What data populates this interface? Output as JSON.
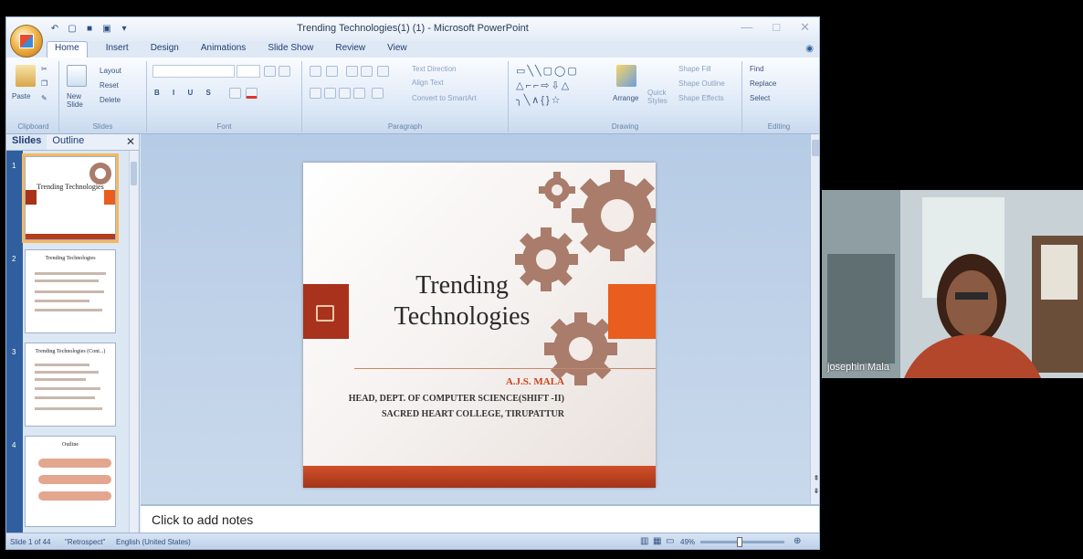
{
  "window": {
    "title": "Trending Technologies(1) (1) - Microsoft PowerPoint"
  },
  "ribbon_tabs": [
    "Home",
    "Insert",
    "Design",
    "Animations",
    "Slide Show",
    "Review",
    "View"
  ],
  "ribbon": {
    "clipboard": {
      "paste": "Paste",
      "group": "Clipboard"
    },
    "slides": {
      "new_slide": "New Slide",
      "layout": "Layout",
      "reset": "Reset",
      "delete": "Delete",
      "group": "Slides"
    },
    "font": {
      "group": "Font"
    },
    "paragraph": {
      "text_direction": "Text Direction",
      "align_text": "Align Text",
      "convert_smartart": "Convert to SmartArt",
      "group": "Paragraph"
    },
    "drawing": {
      "arrange": "Arrange",
      "quick_styles": "Quick Styles",
      "shape_fill": "Shape Fill",
      "shape_outline": "Shape Outline",
      "shape_effects": "Shape Effects",
      "group": "Drawing"
    },
    "editing": {
      "find": "Find",
      "replace": "Replace",
      "select": "Select",
      "group": "Editing"
    }
  },
  "panel": {
    "tabs": [
      "Slides",
      "Outline"
    ],
    "thumbs": [
      {
        "num": "1",
        "title": "Trending Technologies"
      },
      {
        "num": "2",
        "title": "Trending Technologies"
      },
      {
        "num": "3",
        "title": "Trending Technologies (Cont...)"
      },
      {
        "num": "4",
        "title": "Outline"
      }
    ]
  },
  "slide": {
    "title_line1": "Trending",
    "title_line2": "Technologies",
    "author": "A.J.S. MALA",
    "dept": "HEAD, DEPT. OF COMPUTER SCIENCE(SHIFT -II)",
    "college": "SACRED HEART COLLEGE, TIRUPATTUR",
    "accent_red": "#a8321c",
    "accent_orange": "#e95d1e",
    "gear_color": "#a97c6b"
  },
  "notes": {
    "placeholder": "Click to add notes"
  },
  "status": {
    "slide_pos": "Slide 1 of 44",
    "theme": "\"Retrospect\"",
    "language": "English (United States)",
    "zoom": "49%"
  },
  "webcam": {
    "name": "josephin Mala"
  }
}
